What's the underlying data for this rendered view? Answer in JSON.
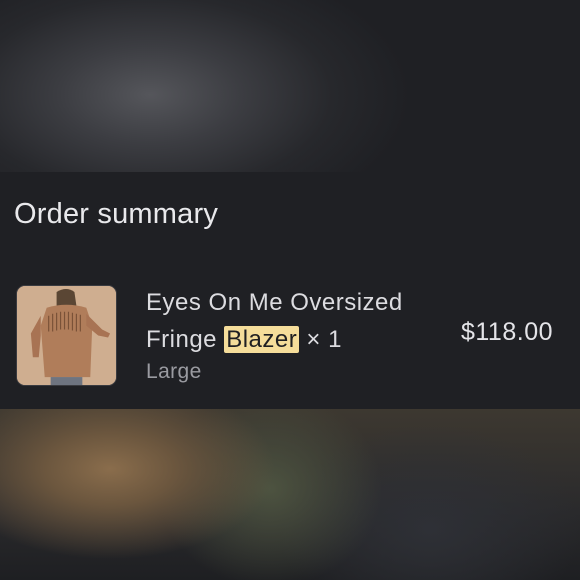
{
  "order_summary": {
    "title": "Order summary",
    "item": {
      "name_part1": "Eyes On Me Oversized Fringe ",
      "name_highlight": "Blazer",
      "quantity_text": " × 1",
      "variant": "Large",
      "price": "$118.00",
      "thumbnail_icon": "blazer-product-photo"
    }
  },
  "colors": {
    "card_background": "#1f2024",
    "highlight": "#f5dd9a",
    "primary_text": "#e9e9ec",
    "secondary_text": "#9a9ba1"
  }
}
